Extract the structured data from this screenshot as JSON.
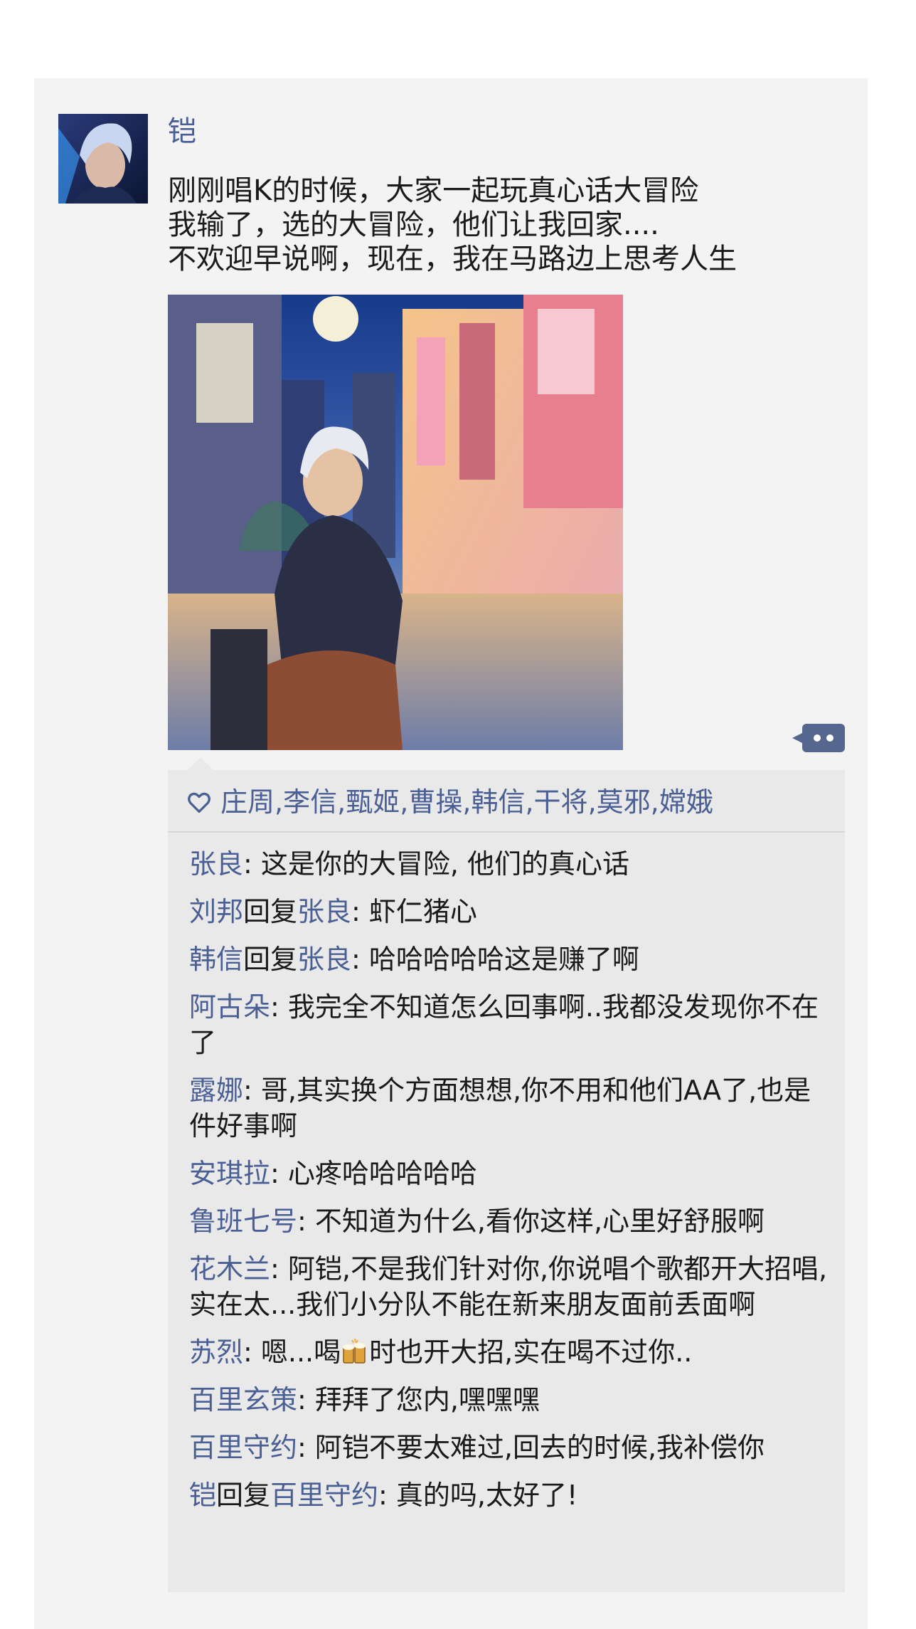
{
  "post": {
    "author": "铠",
    "lines": [
      "刚刚唱K的时候，大家一起玩真心话大冒险",
      "我输了，选的大冒险，他们让我回家....",
      "不欢迎早说啊，现在，我在马路边上思考人生"
    ],
    "photo_icon": "illustrated-photo"
  },
  "likes": {
    "icon": "heart-outline-icon",
    "names": [
      "庄周",
      "李信",
      "甄姬",
      "曹操",
      "韩信",
      "干将",
      "莫邪",
      "嫦娥"
    ],
    "separator": ","
  },
  "comments": [
    {
      "name": "张良",
      "text": ": 这是你的大冒险, 他们的真心话"
    },
    {
      "name": "刘邦",
      "reply_word": "回复",
      "reply_to": "张良",
      "text": ": 虾仁猪心"
    },
    {
      "name": "韩信",
      "reply_word": "回复",
      "reply_to": "张良",
      "text": ": 哈哈哈哈哈这是赚了啊"
    },
    {
      "name": "阿古朵",
      "text": ": 我完全不知道怎么回事啊..我都没发现你不在了"
    },
    {
      "name": "露娜",
      "text": ": 哥,其实换个方面想想,你不用和他们AA了,也是件好事啊"
    },
    {
      "name": "安琪拉",
      "text": ": 心疼哈哈哈哈哈"
    },
    {
      "name": "鲁班七号",
      "text": ": 不知道为什么,看你这样,心里好舒服啊"
    },
    {
      "name": "花木兰",
      "text": ": 阿铠,不是我们针对你,你说唱个歌都开大招唱,实在太...我们小分队不能在新来朋友面前丢面啊"
    },
    {
      "name": "苏烈",
      "text": ": 嗯...喝",
      "text_after": "时也开大招,实在喝不过你..",
      "emoji": "beer-icon"
    },
    {
      "name": "百里玄策",
      "text": ": 拜拜了您内,嘿嘿嘿"
    },
    {
      "name": "百里守约",
      "text": ": 阿铠不要太难过,回去的时候,我补偿你"
    },
    {
      "name": "铠",
      "reply_word": "回复",
      "reply_to": "百里守约",
      "text": ": 真的吗,太好了!"
    }
  ],
  "colors": {
    "name_blue": "#4a5f93",
    "text": "#1a1a1a",
    "panel": "#e9e9e9",
    "card": "#f3f3f3"
  }
}
